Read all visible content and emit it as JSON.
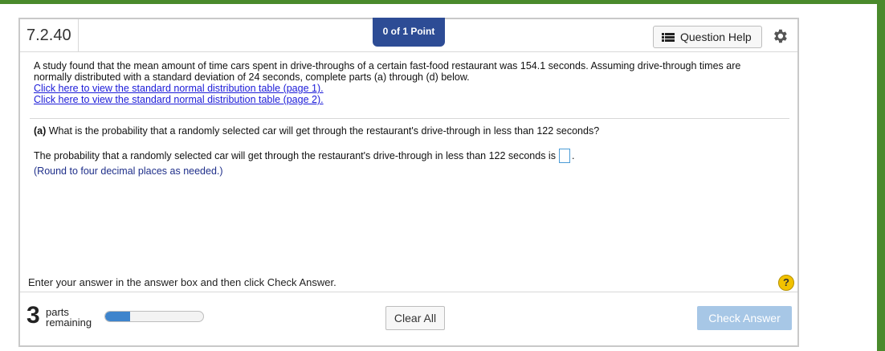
{
  "header": {
    "question_number": "7.2.40",
    "points": "0 of 1 Point",
    "help_label": "Question Help"
  },
  "problem": {
    "text": "A study found that the mean amount of time cars spent in drive-throughs of a certain fast-food restaurant was 154.1 seconds. Assuming drive-through times are normally distributed with a standard deviation of 24 seconds, complete parts (a) through (d) below.",
    "link1": "Click here to view the standard normal distribution table (page 1).",
    "link2": "Click here to view the standard normal distribution table (page 2)."
  },
  "part_a": {
    "label": "(a)",
    "question": " What is the probability that a randomly selected car will get through the restaurant's drive-through in less than 122 seconds?",
    "answer_prefix": "The probability that a randomly selected car will get through the restaurant's drive-through in less than 122 seconds is",
    "answer_value": "",
    "answer_suffix": ".",
    "note": "(Round to four decimal places as needed.)"
  },
  "footer": {
    "instruction": "Enter your answer in the answer box and then click Check Answer.",
    "parts_count": "3",
    "parts_line1": "parts",
    "parts_line2": "remaining",
    "progress": 0.25,
    "clear_label": "Clear All",
    "check_label": "Check Answer"
  },
  "colors": {
    "frame": "#4a8a2c",
    "points_badge": "#2d4c95",
    "link": "#1b1bd8",
    "progress": "#3e84cc",
    "check_button": "#a7c7e6"
  },
  "icons": [
    "list-icon",
    "gear-icon",
    "help-question-icon"
  ]
}
